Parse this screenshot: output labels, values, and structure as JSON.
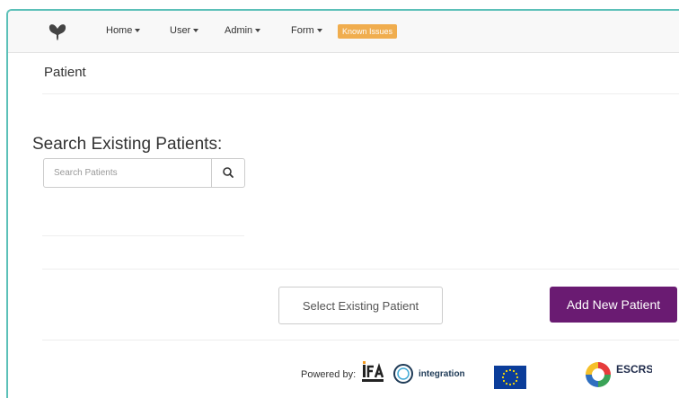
{
  "nav": {
    "items": [
      {
        "label": "Home"
      },
      {
        "label": "User"
      },
      {
        "label": "Admin"
      },
      {
        "label": "Form"
      }
    ],
    "badge": "Known Issues"
  },
  "page": {
    "title": "Patient"
  },
  "search": {
    "heading": "Search Existing Patients:",
    "placeholder": "Search Patients",
    "value": ""
  },
  "actions": {
    "select_label": "Select Existing Patient",
    "add_label": "Add New Patient"
  },
  "footer": {
    "powered_by": "Powered by:",
    "integration_label": "integration"
  },
  "icons": {
    "logo": "butterfly-logo",
    "search": "search-icon"
  },
  "colors": {
    "primary_purple": "#6a1b72",
    "badge_orange": "#f0ad4e",
    "frame_teal": "#5bc0b8"
  }
}
